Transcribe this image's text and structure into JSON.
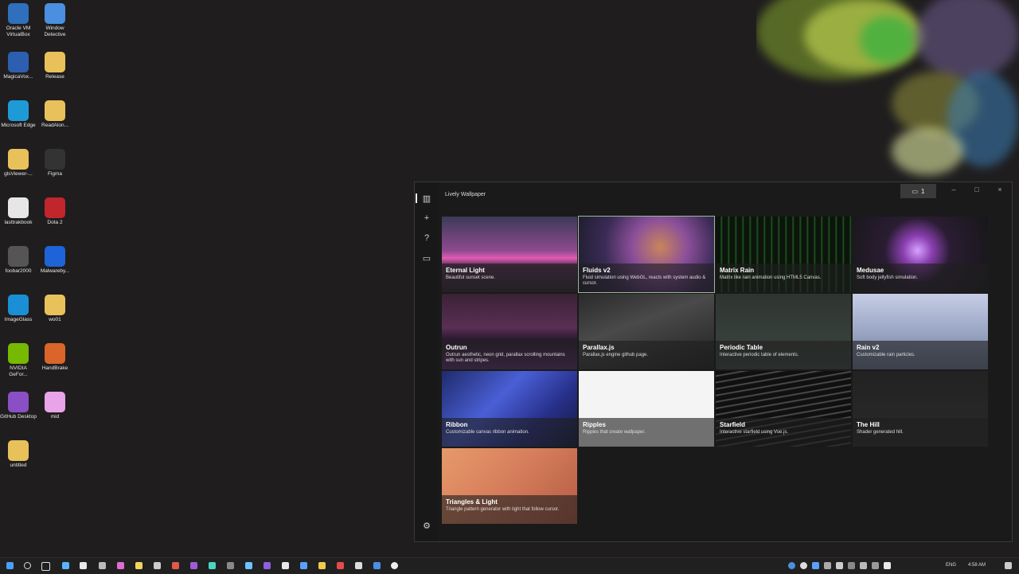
{
  "desktop": {
    "icons": [
      {
        "label": "Oracle VM VirtualBox",
        "icon": "virtualbox-icon",
        "color": "#2f6fbd"
      },
      {
        "label": "Window Detective",
        "icon": "window-detective-icon",
        "color": "#4a8fe0"
      },
      {
        "label": "MagicaVox...",
        "icon": "magicavoxel-icon",
        "color": "#2d5fb0"
      },
      {
        "label": "Release",
        "icon": "folder-icon",
        "color": "#e8c15a"
      },
      {
        "label": "Microsoft Edge",
        "icon": "edge-icon",
        "color": "#1e9bd7"
      },
      {
        "label": "ReadAlon...",
        "icon": "folder-icon",
        "color": "#e8c15a"
      },
      {
        "label": "glsViewer-...",
        "icon": "folder-icon",
        "color": "#e8c15a"
      },
      {
        "label": "Figma",
        "icon": "figma-icon",
        "color": "#333333"
      },
      {
        "label": "lasttrakbook",
        "icon": "app-icon",
        "color": "#e6e6e6"
      },
      {
        "label": "Dota 2",
        "icon": "dota-icon",
        "color": "#c0262b"
      },
      {
        "label": "foobar2000",
        "icon": "foobar-icon",
        "color": "#555555"
      },
      {
        "label": "Malwareby...",
        "icon": "malwarebytes-icon",
        "color": "#1f63d8"
      },
      {
        "label": "ImageGlass",
        "icon": "imageglass-icon",
        "color": "#1a8fd6"
      },
      {
        "label": "wo01",
        "icon": "folder-icon",
        "color": "#e8c15a"
      },
      {
        "label": "NVIDIA GeFor...",
        "icon": "nvidia-icon",
        "color": "#76b900"
      },
      {
        "label": "HandBrake",
        "icon": "handbrake-icon",
        "color": "#d9652b"
      },
      {
        "label": "GitHub Desktop",
        "icon": "github-icon",
        "color": "#8a4fc4"
      },
      {
        "label": "mid",
        "icon": "app-icon",
        "color": "#e9a3e8"
      },
      {
        "label": "untitled",
        "icon": "file-icon",
        "color": "#e8c15a"
      }
    ]
  },
  "window": {
    "title": "Lively Wallpaper",
    "monitor_label": "1",
    "sidebar": {
      "library_icon": "library-icon",
      "add_icon": "plus-icon",
      "help_icon": "help-icon",
      "feedback_icon": "feedback-icon",
      "settings_icon": "gear-icon"
    },
    "controls": {
      "minimize": "–",
      "maximize": "□",
      "close": "×"
    },
    "tiles": [
      {
        "title": "Eternal Light",
        "desc": "Beautiful sunset scene.",
        "bg": "linear-gradient(180deg,#3c3a57 0%,#8e4a8f 45%,#e05bb3 55%,#5a2f57 65%,#2b2330 100%)"
      },
      {
        "title": "Fluids v2",
        "desc": "Fluid simulation using WebGL, reacts with system audio & cursor.",
        "bg": "radial-gradient(circle at 60% 40%,#c9855b 0%,#8b4f9a 30%,#3a2b55 60%,#1c1a28 100%)"
      },
      {
        "title": "Matrix Rain",
        "desc": "Matrix like rain animation using HTML5 Canvas.",
        "bg": "repeating-linear-gradient(90deg,#0c140c 0px,#0c140c 6px,#1f5f1f 7px,#0c140c 9px)"
      },
      {
        "title": "Medusae",
        "desc": "Soft body jellyfish simulation.",
        "bg": "radial-gradient(circle at 48% 45%,#d7a1ff 0%,#8a3fb0 18%,#2a1d33 40%,#161616 100%)"
      },
      {
        "title": "Outrun",
        "desc": "Outrun aesthetic, neon grid, parallax scrolling mountains with sun and stripes.",
        "bg": "linear-gradient(180deg,#3a2235 0%,#5a2f55 45%,#2a1a2e 60%,#5a2d6b 100%)"
      },
      {
        "title": "Parallax.js",
        "desc": "Parallax.js engine github page.",
        "bg": "linear-gradient(160deg,#2a2a2a 0%,#4a4a4a 40%,#1f1f1f 100%)"
      },
      {
        "title": "Periodic Table",
        "desc": "Interactive periodic table of elements.",
        "bg": "linear-gradient(180deg,#2e3531 0%,#3c4640 100%)"
      },
      {
        "title": "Rain v2",
        "desc": "Customizable rain particles.",
        "bg": "linear-gradient(180deg,#c7cde6 0%,#9aa6c4 50%,#6c7896 100%)"
      },
      {
        "title": "Ribbon",
        "desc": "Customizable canvas ribbon animation.",
        "bg": "linear-gradient(135deg,#1f2a6a 0%,#4a5fd6 40%,#27308a 70%,#151a3a 100%)"
      },
      {
        "title": "Ripples",
        "desc": "Ripples that create wallpaper.",
        "bg": "linear-gradient(180deg,#f4f4f4 0%,#f4f4f4 100%)"
      },
      {
        "title": "Starfield",
        "desc": "Interactive starfield using Vue.js.",
        "bg": "repeating-linear-gradient(170deg,#101010 0px,#101010 5px,#5a5a5a 6px,#101010 8px)"
      },
      {
        "title": "The Hill",
        "desc": "Shader generated hill.",
        "bg": "linear-gradient(180deg,#222 0%,#2a2a2a 100%)"
      },
      {
        "title": "Triangles & Light",
        "desc": "Triangle pattern generator with light that follow cursor.",
        "bg": "linear-gradient(135deg,#e69a6a 0%,#d77f5c 45%,#b35a44 100%)"
      }
    ]
  },
  "taskbar": {
    "lang": "ENG",
    "time": "4:58 AM"
  }
}
